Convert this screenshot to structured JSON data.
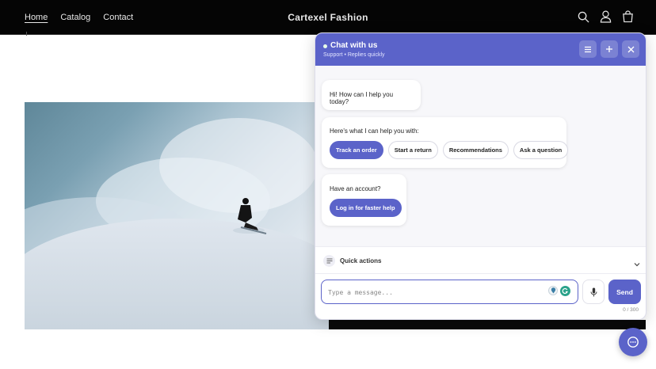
{
  "header": {
    "nav": [
      "Home",
      "Catalog",
      "Contact"
    ],
    "brand": "Cartexel Fashion",
    "icons": [
      "search-icon",
      "account-icon",
      "cart-icon"
    ]
  },
  "hero": {
    "image": "snowboarder-in-powder-snow"
  },
  "chat": {
    "title": "Chat with us",
    "subtitle": "Support • Replies quickly",
    "header_buttons": [
      "menu-icon",
      "plus-icon",
      "close-icon"
    ],
    "greeting": "Hi! How can I help you today?",
    "help_intro": "Here's what I can help you with:",
    "chips": [
      "Track an order",
      "Start a return",
      "Recommendations",
      "Ask a question"
    ],
    "account_prompt": "Have an account?",
    "login_label": "Log in for faster help",
    "quick_actions_label": "Quick actions",
    "input_placeholder": "Type a message...",
    "send_label": "Send",
    "counter": "0 / 300"
  },
  "colors": {
    "accent": "#5b63c9",
    "header_bg": "#050505"
  }
}
